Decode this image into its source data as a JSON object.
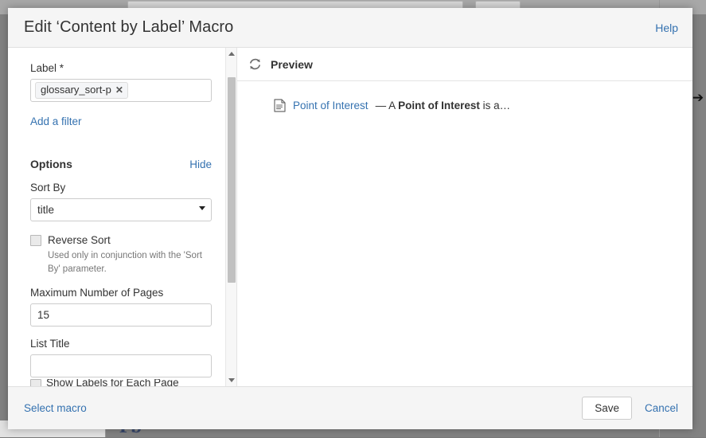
{
  "dialog": {
    "title": "Edit ‘Content by Label’ Macro",
    "help_label": "Help"
  },
  "form": {
    "label_field": {
      "label": "Label *",
      "chip_text": "glossary_sort-p",
      "chip_remove": "✕"
    },
    "add_filter_label": "Add a filter",
    "options": {
      "heading": "Options",
      "hide_label": "Hide"
    },
    "sort_by": {
      "label": "Sort By",
      "value": "title"
    },
    "reverse_sort": {
      "label": "Reverse Sort",
      "checked": false,
      "help_text": "Used only in conjunction with the 'Sort By' parameter."
    },
    "max_pages": {
      "label": "Maximum Number of Pages",
      "value": "15"
    },
    "list_title": {
      "label": "List Title",
      "value": "",
      "placeholder": ""
    },
    "cutoff_row": {
      "label": "Show Labels for Each Page"
    }
  },
  "preview": {
    "title": "Preview",
    "refresh_icon": "refresh-icon",
    "items": [
      {
        "page_icon": "page-icon",
        "link_text": "Point of Interest",
        "separator": " — ",
        "desc_prefix": "A ",
        "desc_bold": "Point of Interest",
        "desc_suffix": " is a…"
      }
    ]
  },
  "footer": {
    "select_macro_label": "Select macro",
    "save_label": "Save",
    "cancel_label": "Cancel"
  },
  "background": {
    "big_text": "Pb",
    "edge_arrow": "➔"
  },
  "colors": {
    "link_blue": "#3572b0",
    "header_bg": "#f5f5f5",
    "backdrop": "#828282",
    "border": "#e0e0e0"
  }
}
